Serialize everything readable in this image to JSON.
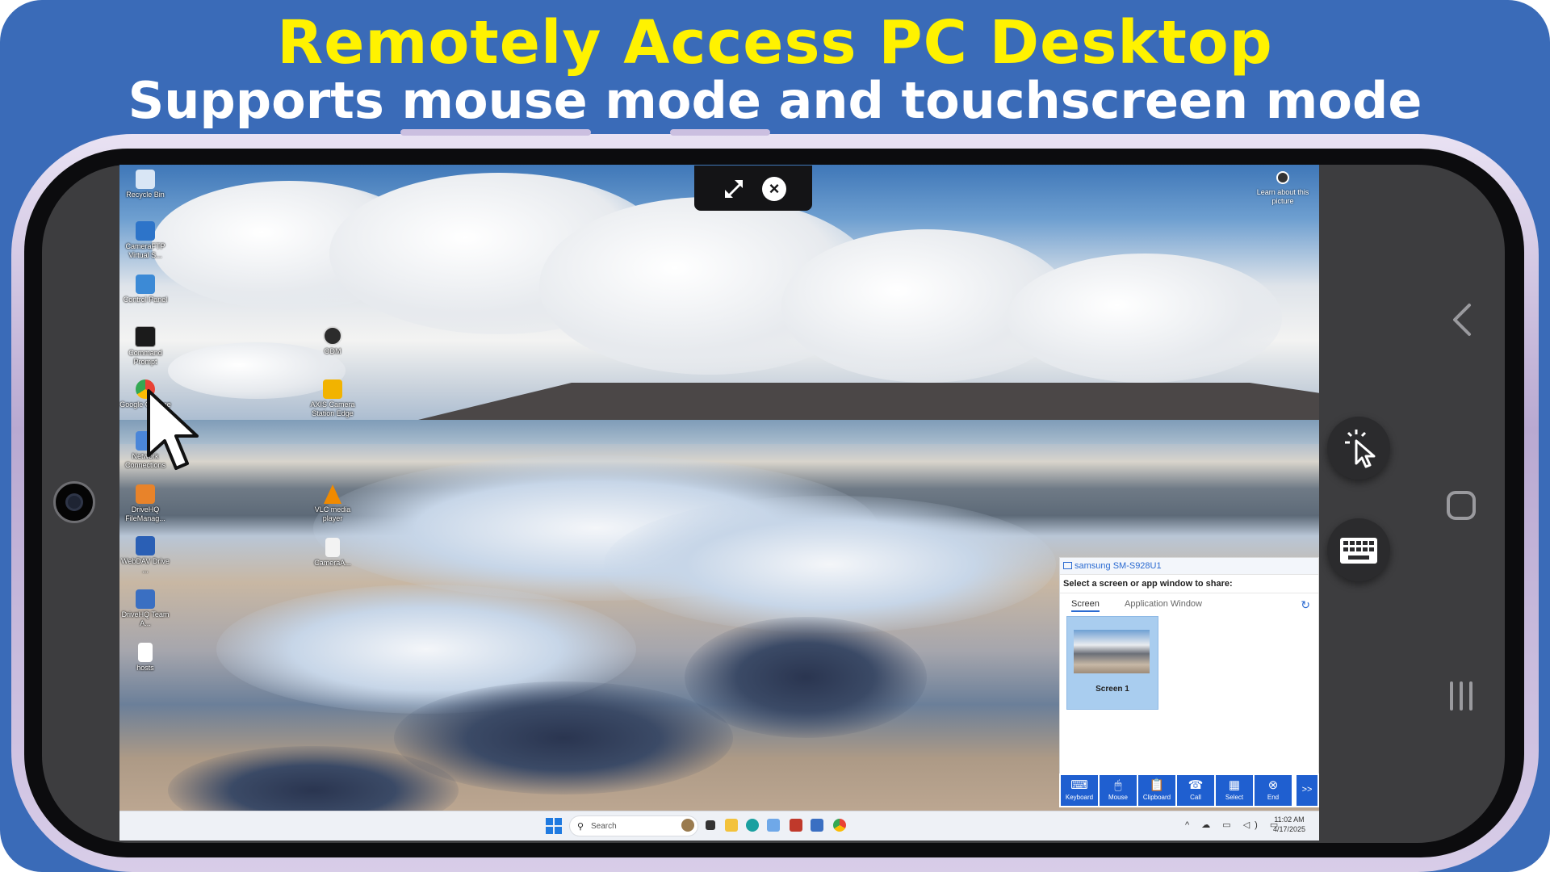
{
  "banner": {
    "title": "Remotely Access PC Desktop",
    "subtitle": "Supports mouse mode and touchscreen mode",
    "colors": {
      "background": "#3a6bb8",
      "title": "#fff200",
      "subtitle": "#ffffff"
    }
  },
  "session_bar": {
    "expand_icon": "expand-icon",
    "close_icon": "close-icon",
    "close_glyph": "×"
  },
  "desktop": {
    "icons": [
      {
        "label": "Recycle Bin",
        "color": "#d9e6f5"
      },
      {
        "label": "CameraFTP Virtual S...",
        "color": "#2d74c9"
      },
      {
        "label": "Control Panel",
        "color": "#3c8ad6"
      },
      {
        "label": "Command Prompt",
        "color": "#1b1b1b"
      },
      {
        "label": "Google Chrome",
        "color": "#e94235"
      },
      {
        "label": "Network Connections",
        "color": "#4a86d9"
      },
      {
        "label": "DriveHQ FileManag...",
        "color": "#e8832a"
      },
      {
        "label": "WebDAV Drive ...",
        "color": "#2a5fb5"
      },
      {
        "label": "DriveHQ Team A...",
        "color": "#3a6fc2"
      },
      {
        "label": "hosts",
        "color": "#ffffff"
      }
    ],
    "center_icons": [
      {
        "label": "ODM",
        "color": "#2c2c2c"
      },
      {
        "label": "AXIS Camera Station Edge",
        "color": "#f2b300"
      },
      {
        "label": "VLC media player",
        "color": "#f08a00"
      },
      {
        "label": "CameraA...",
        "color": "#f3f3f3"
      }
    ],
    "learn_about": "Learn about this picture"
  },
  "share_dialog": {
    "device": "samsung SM-S928U1",
    "prompt": "Select a screen or app window to share:",
    "tabs": [
      "Screen",
      "Application Window"
    ],
    "active_tab": "Screen",
    "refresh_icon": "refresh-icon",
    "thumbnail_caption": "Screen 1"
  },
  "toolbar": {
    "buttons": [
      {
        "label": "Keyboard",
        "glyph": "⌨",
        "icon": "keyboard-icon"
      },
      {
        "label": "Mouse",
        "glyph": "🖱",
        "icon": "mouse-icon"
      },
      {
        "label": "Clipboard",
        "glyph": "📋",
        "icon": "clipboard-icon"
      },
      {
        "label": "Call",
        "glyph": "☎",
        "icon": "phone-icon"
      },
      {
        "label": "Select",
        "glyph": "▦",
        "icon": "grid-icon"
      },
      {
        "label": "End",
        "glyph": "⊗",
        "icon": "end-icon"
      }
    ],
    "more_label": ">>"
  },
  "taskbar": {
    "search_placeholder": "Search",
    "tray_glyphs": "^ ☁ ▭ ◁) ▭",
    "time": "11:02 AM",
    "date": "4/17/2025",
    "colors": {
      "start": "#1f7ae0"
    }
  },
  "side_controls": {
    "mouse_mode_icon": "pointer-click-icon",
    "keyboard_icon": "keyboard-grid-icon",
    "nav_back": "back-icon",
    "nav_home": "home-icon",
    "nav_recents": "recents-icon"
  }
}
